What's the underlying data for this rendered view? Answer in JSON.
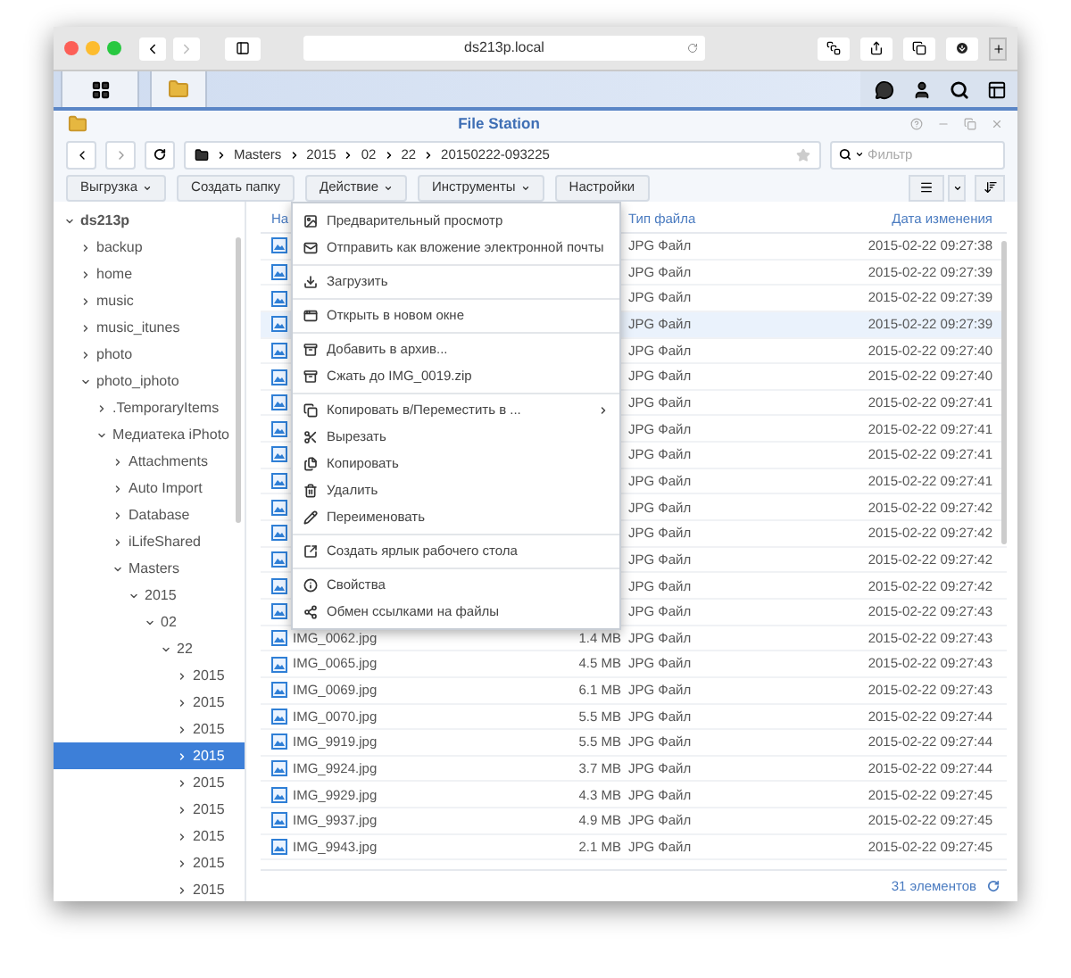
{
  "browser": {
    "url": "ds213p.local"
  },
  "window": {
    "title": "File Station"
  },
  "path": [
    "Masters",
    "2015",
    "02",
    "22",
    "20150222-093225"
  ],
  "filter": {
    "placeholder": "Фильтр"
  },
  "toolbar": [
    {
      "label": "Выгрузка",
      "dropdown": true
    },
    {
      "label": "Создать папку",
      "dropdown": false
    },
    {
      "label": "Действие",
      "dropdown": true
    },
    {
      "label": "Инструменты",
      "dropdown": true
    },
    {
      "label": "Настройки",
      "dropdown": false
    }
  ],
  "tree": [
    {
      "label": "ds213p",
      "expanded": true,
      "selected": false,
      "children": [
        {
          "label": "backup",
          "expanded": false,
          "selected": false
        },
        {
          "label": "home",
          "expanded": false,
          "selected": false
        },
        {
          "label": "music",
          "expanded": false,
          "selected": false
        },
        {
          "label": "music_itunes",
          "expanded": false,
          "selected": false
        },
        {
          "label": "photo",
          "expanded": false,
          "selected": false
        },
        {
          "label": "photo_iphoto",
          "expanded": true,
          "selected": false,
          "children": [
            {
              "label": ".TemporaryItems",
              "expanded": false,
              "selected": false
            },
            {
              "label": "Медиатека iPhoto",
              "expanded": true,
              "selected": false,
              "children": [
                {
                  "label": "Attachments",
                  "expanded": false,
                  "selected": false
                },
                {
                  "label": "Auto Import",
                  "expanded": false,
                  "selected": false
                },
                {
                  "label": "Database",
                  "expanded": false,
                  "selected": false
                },
                {
                  "label": "iLifeShared",
                  "expanded": false,
                  "selected": false
                },
                {
                  "label": "Masters",
                  "expanded": true,
                  "selected": false,
                  "children": [
                    {
                      "label": "2015",
                      "expanded": true,
                      "selected": false,
                      "children": [
                        {
                          "label": "02",
                          "expanded": true,
                          "selected": false,
                          "children": [
                            {
                              "label": "22",
                              "expanded": true,
                              "selected": false,
                              "children": [
                                {
                                  "label": "2015",
                                  "expanded": false,
                                  "selected": false
                                },
                                {
                                  "label": "2015",
                                  "expanded": false,
                                  "selected": false
                                },
                                {
                                  "label": "2015",
                                  "expanded": false,
                                  "selected": false
                                },
                                {
                                  "label": "2015",
                                  "expanded": false,
                                  "selected": true
                                },
                                {
                                  "label": "2015",
                                  "expanded": false,
                                  "selected": false
                                },
                                {
                                  "label": "2015",
                                  "expanded": false,
                                  "selected": false
                                },
                                {
                                  "label": "2015",
                                  "expanded": false,
                                  "selected": false
                                },
                                {
                                  "label": "2015",
                                  "expanded": false,
                                  "selected": false
                                },
                                {
                                  "label": "2015",
                                  "expanded": false,
                                  "selected": false
                                }
                              ]
                            }
                          ]
                        }
                      ]
                    }
                  ]
                }
              ]
            }
          ]
        }
      ]
    }
  ],
  "table": {
    "columns": [
      "На",
      "Тип файла",
      "Дата изменения"
    ],
    "rows": [
      {
        "type": "JPG Файл",
        "date": "2015-02-22 09:27:38",
        "selected": false
      },
      {
        "type": "JPG Файл",
        "date": "2015-02-22 09:27:39",
        "selected": false
      },
      {
        "type": "JPG Файл",
        "date": "2015-02-22 09:27:39",
        "selected": false
      },
      {
        "type": "JPG Файл",
        "date": "2015-02-22 09:27:39",
        "selected": true
      },
      {
        "type": "JPG Файл",
        "date": "2015-02-22 09:27:40",
        "selected": false
      },
      {
        "type": "JPG Файл",
        "date": "2015-02-22 09:27:40",
        "selected": false
      },
      {
        "type": "JPG Файл",
        "date": "2015-02-22 09:27:41",
        "selected": false
      },
      {
        "type": "JPG Файл",
        "date": "2015-02-22 09:27:41",
        "selected": false
      },
      {
        "type": "JPG Файл",
        "date": "2015-02-22 09:27:41",
        "selected": false
      },
      {
        "type": "JPG Файл",
        "date": "2015-02-22 09:27:41",
        "selected": false
      },
      {
        "type": "JPG Файл",
        "date": "2015-02-22 09:27:42",
        "selected": false
      },
      {
        "type": "JPG Файл",
        "date": "2015-02-22 09:27:42",
        "selected": false
      },
      {
        "type": "JPG Файл",
        "date": "2015-02-22 09:27:42",
        "selected": false
      },
      {
        "type": "JPG Файл",
        "date": "2015-02-22 09:27:42",
        "selected": false
      },
      {
        "type": "JPG Файл",
        "date": "2015-02-22 09:27:43",
        "selected": false
      },
      {
        "name": "IMG_0062.jpg",
        "size": "1.4 MB",
        "type": "JPG Файл",
        "date": "2015-02-22 09:27:43",
        "selected": false
      },
      {
        "name": "IMG_0065.jpg",
        "size": "4.5 MB",
        "type": "JPG Файл",
        "date": "2015-02-22 09:27:43",
        "selected": false
      },
      {
        "name": "IMG_0069.jpg",
        "size": "6.1 MB",
        "type": "JPG Файл",
        "date": "2015-02-22 09:27:43",
        "selected": false
      },
      {
        "name": "IMG_0070.jpg",
        "size": "5.5 MB",
        "type": "JPG Файл",
        "date": "2015-02-22 09:27:44",
        "selected": false
      },
      {
        "name": "IMG_9919.jpg",
        "size": "5.5 MB",
        "type": "JPG Файл",
        "date": "2015-02-22 09:27:44",
        "selected": false
      },
      {
        "name": "IMG_9924.jpg",
        "size": "3.7 MB",
        "type": "JPG Файл",
        "date": "2015-02-22 09:27:44",
        "selected": false
      },
      {
        "name": "IMG_9929.jpg",
        "size": "4.3 MB",
        "type": "JPG Файл",
        "date": "2015-02-22 09:27:45",
        "selected": false
      },
      {
        "name": "IMG_9937.jpg",
        "size": "4.9 MB",
        "type": "JPG Файл",
        "date": "2015-02-22 09:27:45",
        "selected": false
      },
      {
        "name": "IMG_9943.jpg",
        "size": "2.1 MB",
        "type": "JPG Файл",
        "date": "2015-02-22 09:27:45",
        "selected": false
      }
    ]
  },
  "status_bar": {
    "count": "31 элементов"
  },
  "context_menu": [
    {
      "kind": "preview",
      "label": "Предварительный просмотр"
    },
    {
      "kind": "mail",
      "label": "Отправить как вложение электронной почты"
    },
    {
      "kind": "separator"
    },
    {
      "kind": "download",
      "label": "Загрузить"
    },
    {
      "kind": "separator"
    },
    {
      "kind": "window",
      "label": "Открыть в новом окне"
    },
    {
      "kind": "separator"
    },
    {
      "kind": "archive",
      "label": "Добавить в архив..."
    },
    {
      "kind": "archive",
      "label": "Сжать до IMG_0019.zip"
    },
    {
      "kind": "separator"
    },
    {
      "kind": "copymove",
      "label": "Копировать в/Переместить в ...",
      "submenu": true
    },
    {
      "kind": "cut",
      "label": "Вырезать"
    },
    {
      "kind": "copy",
      "label": "Копировать"
    },
    {
      "kind": "delete",
      "label": "Удалить"
    },
    {
      "kind": "rename",
      "label": "Переименовать"
    },
    {
      "kind": "separator"
    },
    {
      "kind": "shortcut",
      "label": "Создать ярлык рабочего стола"
    },
    {
      "kind": "separator"
    },
    {
      "kind": "info",
      "label": "Свойства"
    },
    {
      "kind": "share",
      "label": "Обмен ссылками на файлы"
    }
  ]
}
